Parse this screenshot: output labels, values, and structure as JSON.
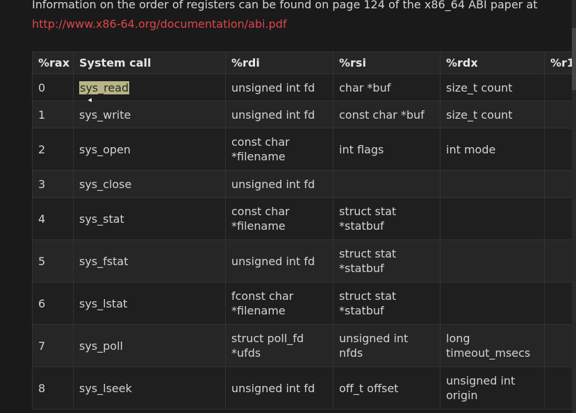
{
  "intro": {
    "text": "Information on the order of registers can be found on page 124 of the x86_64 ABI paper at",
    "link": "http://www.x86-64.org/documentation/abi.pdf"
  },
  "table": {
    "headers": [
      "%rax",
      "System call",
      "%rdi",
      "%rsi",
      "%rdx",
      "%r1("
    ],
    "rows": [
      {
        "rax": "0",
        "name": "sys_read",
        "rdi": "unsigned int fd",
        "rsi": "char *buf",
        "rdx": "size_t count",
        "r10": ""
      },
      {
        "rax": "1",
        "name": "sys_write",
        "rdi": "unsigned int fd",
        "rsi": "const char *buf",
        "rdx": "size_t count",
        "r10": ""
      },
      {
        "rax": "2",
        "name": "sys_open",
        "rdi": "const char *filename",
        "rsi": "int flags",
        "rdx": "int mode",
        "r10": ""
      },
      {
        "rax": "3",
        "name": "sys_close",
        "rdi": "unsigned int fd",
        "rsi": "",
        "rdx": "",
        "r10": ""
      },
      {
        "rax": "4",
        "name": "sys_stat",
        "rdi": "const char *filename",
        "rsi": "struct stat *statbuf",
        "rdx": "",
        "r10": ""
      },
      {
        "rax": "5",
        "name": "sys_fstat",
        "rdi": "unsigned int fd",
        "rsi": "struct stat *statbuf",
        "rdx": "",
        "r10": ""
      },
      {
        "rax": "6",
        "name": "sys_lstat",
        "rdi": "fconst char *filename",
        "rsi": "struct stat *statbuf",
        "rdx": "",
        "r10": ""
      },
      {
        "rax": "7",
        "name": "sys_poll",
        "rdi": "struct poll_fd *ufds",
        "rsi": "unsigned int nfds",
        "rdx": "long timeout_msecs",
        "r10": ""
      },
      {
        "rax": "8",
        "name": "sys_lseek",
        "rdi": "unsigned int fd",
        "rsi": "off_t offset",
        "rdx": "unsigned int origin",
        "r10": ""
      }
    ]
  },
  "colors": {
    "background": "#1a1a1a",
    "link": "#e0454a",
    "highlight": "#b8b58a"
  }
}
